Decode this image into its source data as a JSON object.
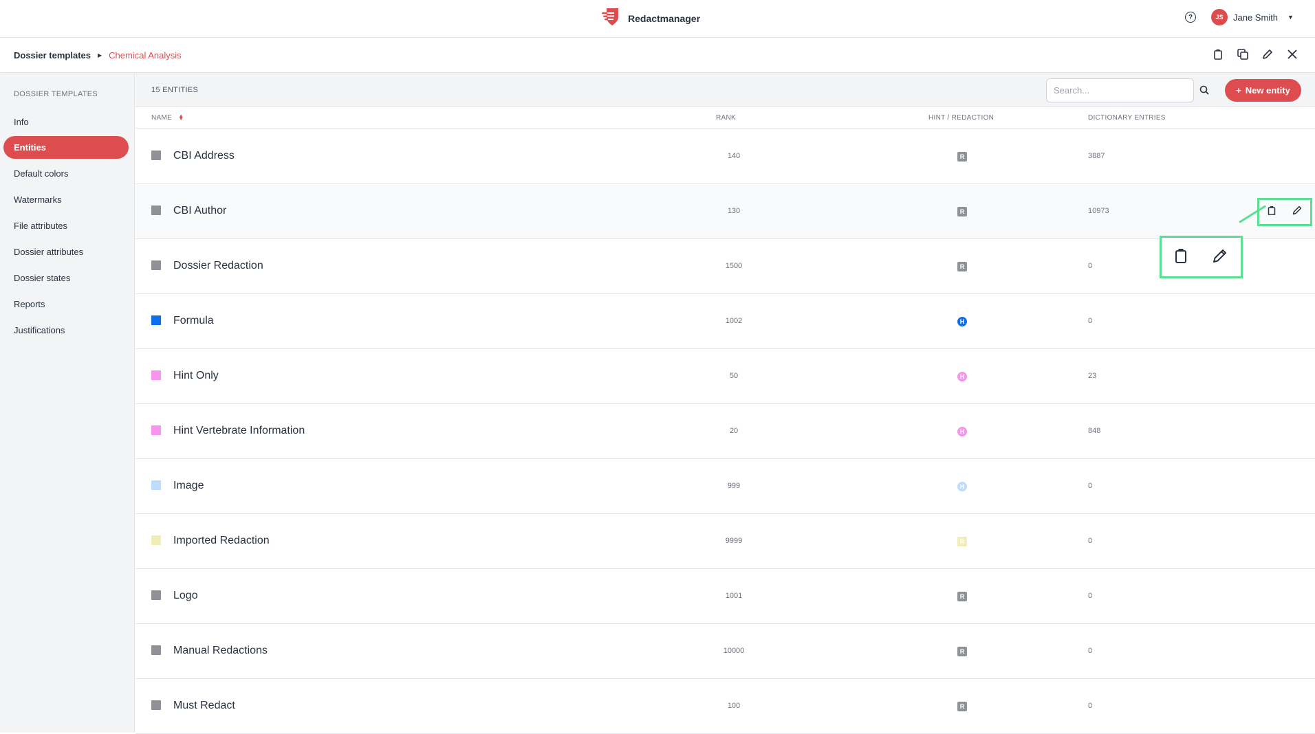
{
  "app": {
    "name": "Redactmanager"
  },
  "user": {
    "initials": "JS",
    "name": "Jane Smith"
  },
  "breadcrumb": {
    "root": "Dossier templates",
    "current": "Chemical Analysis"
  },
  "sidebar": {
    "title": "DOSSIER TEMPLATES",
    "items": [
      {
        "label": "Info",
        "active": false
      },
      {
        "label": "Entities",
        "active": true
      },
      {
        "label": "Default colors",
        "active": false
      },
      {
        "label": "Watermarks",
        "active": false
      },
      {
        "label": "File attributes",
        "active": false
      },
      {
        "label": "Dossier attributes",
        "active": false
      },
      {
        "label": "Dossier states",
        "active": false
      },
      {
        "label": "Reports",
        "active": false
      },
      {
        "label": "Justifications",
        "active": false
      }
    ]
  },
  "toolbar": {
    "count_label": "15 ENTITIES",
    "search_placeholder": "Search...",
    "new_button_label": "New entity"
  },
  "table": {
    "columns": {
      "name": "NAME",
      "rank": "RANK",
      "type": "HINT / REDACTION",
      "dict": "DICTIONARY ENTRIES"
    },
    "rows": [
      {
        "name": "CBI Address",
        "rank": "140",
        "badge": "R",
        "kind": "redaction",
        "color": "#8e9198",
        "entries": "3887"
      },
      {
        "name": "CBI Author",
        "rank": "130",
        "badge": "R",
        "kind": "redaction",
        "color": "#8e9198",
        "entries": "10973"
      },
      {
        "name": "Dossier Redaction",
        "rank": "1500",
        "badge": "R",
        "kind": "redaction",
        "color": "#8e9198",
        "entries": "0"
      },
      {
        "name": "Formula",
        "rank": "1002",
        "badge": "H",
        "kind": "hint",
        "color": "#0f6fe9",
        "entries": "0"
      },
      {
        "name": "Hint Only",
        "rank": "50",
        "badge": "H",
        "kind": "hint",
        "color": "#f694ee",
        "entries": "23"
      },
      {
        "name": "Hint Vertebrate Information",
        "rank": "20",
        "badge": "H",
        "kind": "hint",
        "color": "#f694ee",
        "entries": "848"
      },
      {
        "name": "Image",
        "rank": "999",
        "badge": "H",
        "kind": "hint",
        "color": "#bfdbfe",
        "entries": "0"
      },
      {
        "name": "Imported Redaction",
        "rank": "9999",
        "badge": "R",
        "kind": "redaction",
        "color": "#f0edb5",
        "entries": "0"
      },
      {
        "name": "Logo",
        "rank": "1001",
        "badge": "R",
        "kind": "redaction",
        "color": "#8e9198",
        "entries": "0"
      },
      {
        "name": "Manual Redactions",
        "rank": "10000",
        "badge": "R",
        "kind": "redaction",
        "color": "#8e9198",
        "entries": "0"
      },
      {
        "name": "Must Redact",
        "rank": "100",
        "badge": "R",
        "kind": "redaction",
        "color": "#8e9198",
        "entries": "0"
      }
    ]
  },
  "colors": {
    "accent": "#dd4d50",
    "highlight": "#5bdf92"
  }
}
